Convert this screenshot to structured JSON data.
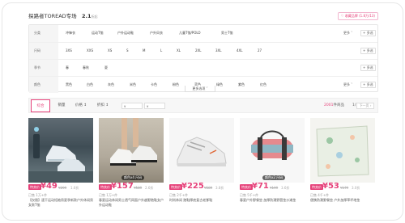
{
  "header": {
    "brand_title": "探路者TOREAD专场",
    "count_value": "2.1",
    "count_suffix": "折起",
    "favorite_label": "收藏品牌",
    "favorite_count": "(1.8万/13)"
  },
  "filters": {
    "rows": [
      {
        "label": "分类",
        "options": [
          "冲锋衣",
          "运动T恤",
          "户外运动鞋",
          "户外风衣",
          "儿童T恤/POLO",
          "男士T恤"
        ]
      },
      {
        "label": "尺码",
        "options": [
          "3XS",
          "XXS",
          "XS",
          "S",
          "M",
          "L",
          "XL",
          "2XL",
          "3XL",
          "4XL",
          "27"
        ]
      },
      {
        "label": "季节",
        "options": [
          "春",
          "春秋",
          "夏"
        ]
      },
      {
        "label": "颜色",
        "options": [
          "黑色",
          "白色",
          "灰色",
          "米色",
          "卡色",
          "粉色",
          "蓝色",
          "绿色",
          "紫色",
          "红色"
        ]
      }
    ],
    "more_label": "更多 ˅",
    "multi_label": "+ 多选",
    "more_options_label": "更多选项 ˅"
  },
  "sort": {
    "options": [
      "综合",
      "销量",
      "价格 ↕",
      "折扣 ↕"
    ],
    "price_min_placeholder": "¥",
    "price_max_placeholder": "¥",
    "total_count": "2001",
    "total_suffix": "件商品",
    "page_current": "1/11",
    "prev_label": "‹",
    "next_label": "下一页 ›"
  },
  "products": [
    {
      "tag": "特卖价",
      "price": "¥49",
      "orig": "¥299",
      "discount": "1.6折",
      "sold": "已售 1万+件",
      "title": "【仅限】速干运动短袖男夏季新款户外休闲男女款T恤",
      "overlay": ""
    },
    {
      "tag": "特卖价",
      "price": "¥157",
      "orig": "¥589",
      "discount": "2.6折",
      "sold": "已售 1万+件",
      "title": "春夏运动休闲男士透气网面户外越野跑鞋女户外运动鞋",
      "overlay": "颜色x4 尺码"
    },
    {
      "tag": "特卖价",
      "price": "¥225",
      "orig": "¥589",
      "discount": "3.8折",
      "sold": "已售 2千+件",
      "title": "时尚休闲 跑鞋厚底复古老爹鞋",
      "overlay": ""
    },
    {
      "tag": "特卖价",
      "price": "¥71",
      "orig": "¥199",
      "discount": "3.6折",
      "sold": "已售 5千+件",
      "title": "春夏户外野餐垫 加厚防潮野营垫沙滩垫",
      "overlay": "颜色x2 尺码"
    },
    {
      "tag": "特卖价",
      "price": "¥53",
      "orig": "¥179",
      "discount": "3.0折",
      "sold": "已售 4千+件",
      "title": "便携防潮野餐垫 户外加厚草坪地垫",
      "overlay": ""
    }
  ],
  "colors": {
    "accent": "#e6427a"
  }
}
